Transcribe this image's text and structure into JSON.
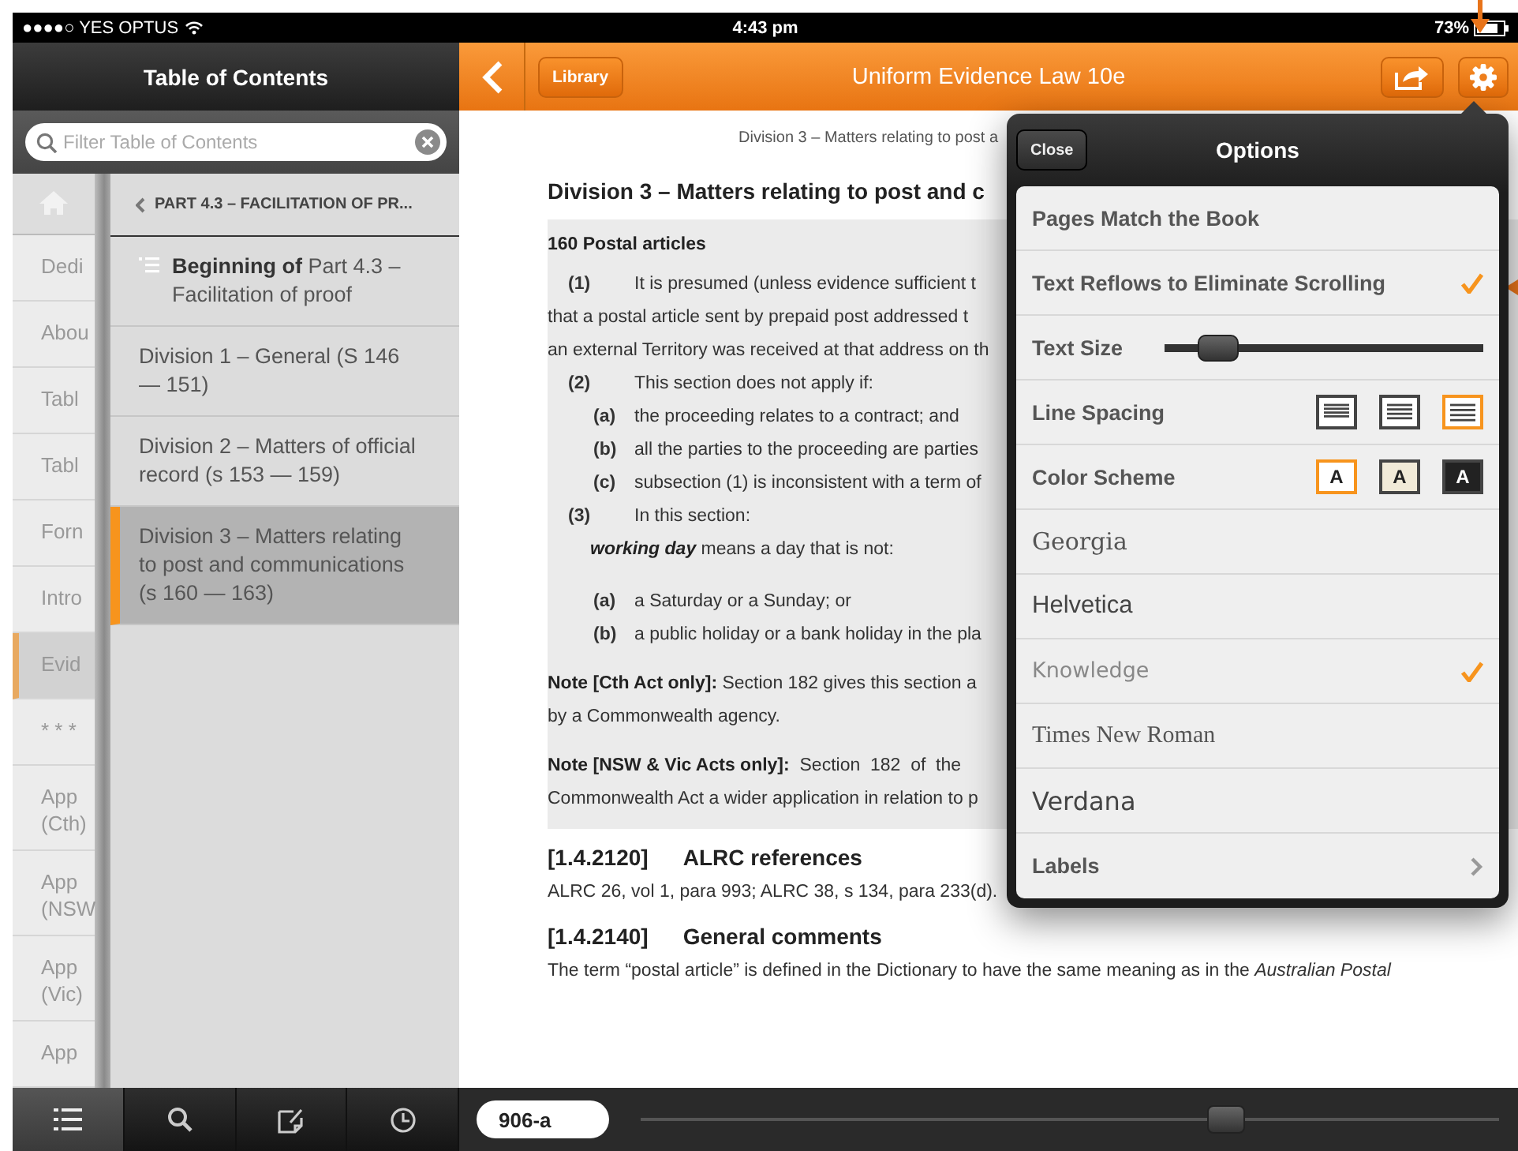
{
  "status_bar": {
    "carrier": "●●●●○ YES OPTUS",
    "time": "4:43 pm",
    "battery": "73%"
  },
  "toc": {
    "title": "Table of Contents",
    "filter": {
      "placeholder": "Filter Table of Contents"
    },
    "outer_items": [
      {
        "label": "Dedi",
        "selected": false
      },
      {
        "label": "Abou",
        "selected": false
      },
      {
        "label": "Tabl",
        "selected": false
      },
      {
        "label": "Tabl",
        "selected": false
      },
      {
        "label": "Forn",
        "selected": false
      },
      {
        "label": "Intro",
        "selected": false
      },
      {
        "label": "Evid",
        "selected": true
      },
      {
        "label": "* * *",
        "selected": false
      },
      {
        "label": "App (Cth)",
        "selected": false
      },
      {
        "label": "App (NSW",
        "selected": false
      },
      {
        "label": "App (Vic)",
        "selected": false
      },
      {
        "label": "App",
        "selected": false
      }
    ],
    "part": "PART 4.3 – FACILITATION OF PR...",
    "items": [
      {
        "kind": "beginning",
        "label": "**Beginning of** Part 4.3 – Facilitation of proof",
        "selected": false
      },
      {
        "kind": "division",
        "label": "Division 1 – General (S 146 — 151)",
        "selected": false
      },
      {
        "kind": "division",
        "label": "Division 2 – Matters of official record (s 153 — 159)",
        "selected": false
      },
      {
        "kind": "division",
        "label": "Division 3 – Matters relating to post and communications (s 160 — 163)",
        "selected": true
      }
    ]
  },
  "toolbar": [
    {
      "kind": "contents",
      "selected": true
    },
    {
      "kind": "search",
      "selected": false
    },
    {
      "kind": "notes",
      "selected": false
    },
    {
      "kind": "history",
      "selected": false
    }
  ],
  "nav": {
    "library": "Library",
    "title": "Uniform Evidence Law 10e"
  },
  "document": {
    "running_head": "Division 3 – Matters relating to post a",
    "heading": "Division 3 – Matters relating to post and c",
    "box": [
      {
        "kind": "section",
        "text": "160  Postal articles"
      },
      {
        "kind": "numbered",
        "num": "(1)",
        "text": "It is presumed (unless evidence sufficient t"
      },
      {
        "kind": "plain",
        "text": "that a postal article sent by prepaid post addressed t"
      },
      {
        "kind": "plain",
        "text": "an external Territory was received at that address on th"
      },
      {
        "kind": "numbered",
        "num": "(2)",
        "text": "This section does not apply if:"
      },
      {
        "kind": "sub",
        "num": "(a)",
        "text": "the proceeding relates to a contract; and"
      },
      {
        "kind": "sub",
        "num": "(b)",
        "text": "all the parties to the proceeding are parties"
      },
      {
        "kind": "sub",
        "num": "(c)",
        "text": "subsection (1) is inconsistent with a term of"
      },
      {
        "kind": "numbered",
        "num": "(3)",
        "text": "In this section:"
      },
      {
        "kind": "definition",
        "text": "**working day** means a day that is not:"
      },
      {
        "kind": "sub",
        "num": "(a)",
        "text": "a Saturday or a Sunday; or"
      },
      {
        "kind": "sub",
        "num": "(b)",
        "text": "a public holiday or a bank holiday in the pla"
      },
      {
        "kind": "note",
        "text": "**Note [Cth Act only]:** Section 182 gives this section a"
      },
      {
        "kind": "plain",
        "text": "by a Commonwealth agency."
      },
      {
        "kind": "note",
        "text": "**Note [NSW & Vic Acts only]:**  Section  182  of  the"
      },
      {
        "kind": "plain",
        "text": "Commonwealth Act a wider application in relation to p"
      }
    ],
    "sections": [
      {
        "ref": "[1.4.2120]",
        "title": "ALRC references",
        "text": "ALRC 26, vol 1, para 993; ALRC 38, s 134, para 233(d)."
      },
      {
        "ref": "[1.4.2140]",
        "title": "General comments",
        "text": "The term “postal article” is defined in the Dictionary to have the same meaning as in the *Australian Postal*"
      }
    ]
  },
  "page_field": {
    "value": "906-a"
  },
  "page_slider": {
    "level": 0.66
  },
  "options": {
    "close": "Close",
    "title": "Options",
    "rows": [
      {
        "kind": "check",
        "label": "Pages Match the Book",
        "checked": false
      },
      {
        "kind": "check",
        "label": "Text Reflows to Eliminate Scrolling",
        "checked": true
      },
      {
        "kind": "slider",
        "label": "Text Size",
        "level": 0.12
      },
      {
        "kind": "spacing",
        "label": "Line Spacing",
        "choices": [
          {
            "selected": false
          },
          {
            "selected": false
          },
          {
            "selected": true
          }
        ]
      },
      {
        "kind": "scheme",
        "label": "Color Scheme",
        "choices": [
          {
            "label": "A",
            "selected": true
          },
          {
            "label": "A",
            "selected": false
          },
          {
            "label": "A",
            "selected": false
          }
        ]
      },
      {
        "kind": "font",
        "label": "Georgia",
        "checked": false
      },
      {
        "kind": "font",
        "label": "Helvetica",
        "checked": false
      },
      {
        "kind": "font",
        "label": "Knowledge",
        "checked": true
      },
      {
        "kind": "font",
        "label": "Times New Roman",
        "checked": false
      },
      {
        "kind": "font",
        "label": "Verdana",
        "checked": false
      },
      {
        "kind": "link",
        "label": "Labels"
      }
    ]
  }
}
